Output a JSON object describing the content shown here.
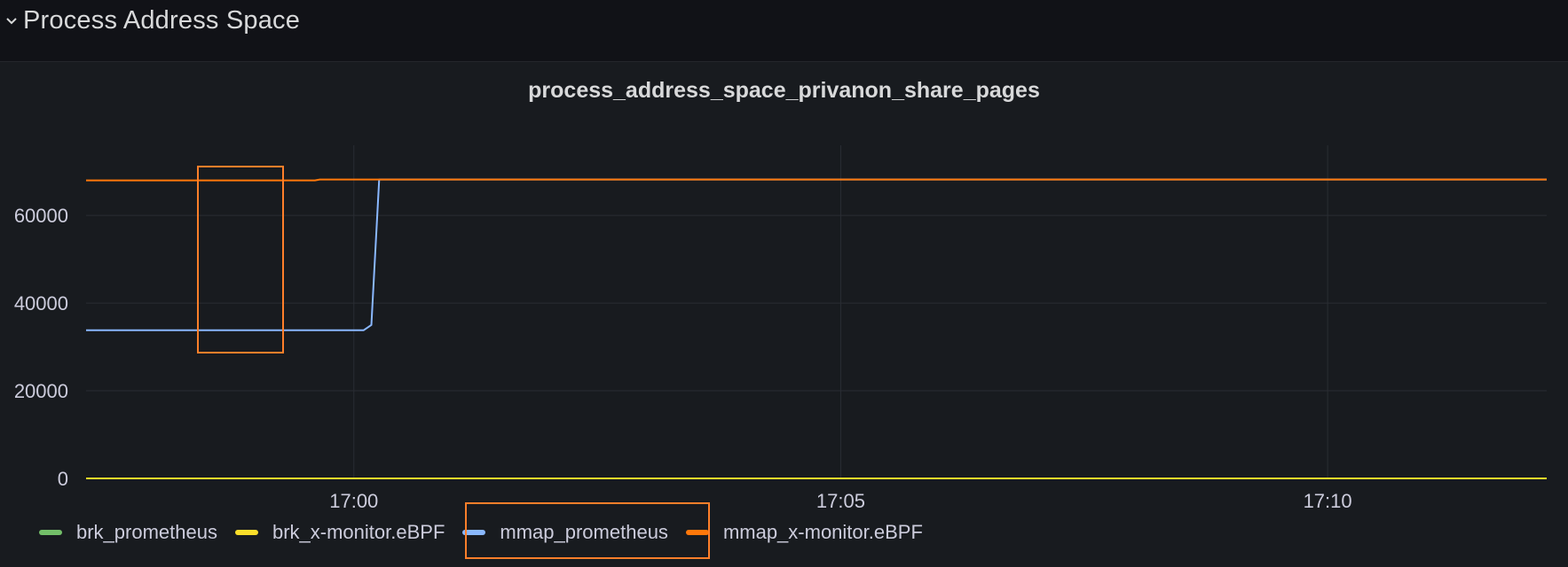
{
  "row": {
    "title": "Process Address Space"
  },
  "panel": {
    "title": "process_address_space_privanon_share_pages"
  },
  "colors": {
    "background": "#181b1f",
    "grid": "#2a2d33",
    "axis_text": "#ccccdc",
    "highlight": "#ff7f2a"
  },
  "chart_data": {
    "type": "line",
    "title": "process_address_space_privanon_share_pages",
    "xlabel": "",
    "ylabel": "",
    "x_range_minutes": [
      -2.75,
      12.25
    ],
    "x_ticks": [
      {
        "value": 0,
        "label": "17:00"
      },
      {
        "value": 5,
        "label": "17:05"
      },
      {
        "value": 10,
        "label": "17:10"
      }
    ],
    "ylim": [
      0,
      76000
    ],
    "y_ticks": [
      0,
      20000,
      40000,
      60000
    ],
    "grid": true,
    "legend_position": "bottom-left",
    "series": [
      {
        "name": "brk_prometheus",
        "color": "#73bf69",
        "points": [
          [
            -2.75,
            0
          ],
          [
            12.25,
            0
          ]
        ]
      },
      {
        "name": "brk_x-monitor.eBPF",
        "color": "#fade2a",
        "points": [
          [
            -2.75,
            0
          ],
          [
            12.25,
            0
          ]
        ]
      },
      {
        "name": "mmap_prometheus",
        "color": "#8ab8ff",
        "points": [
          [
            -2.75,
            33800
          ],
          [
            0.1,
            33800
          ],
          [
            0.18,
            35000
          ],
          [
            0.26,
            68200
          ],
          [
            12.25,
            68200
          ]
        ]
      },
      {
        "name": "mmap_x-monitor.eBPF",
        "color": "#ff780a",
        "points": [
          [
            -2.75,
            68000
          ],
          [
            -0.4,
            68000
          ],
          [
            -0.35,
            68200
          ],
          [
            12.25,
            68200
          ]
        ]
      }
    ]
  }
}
